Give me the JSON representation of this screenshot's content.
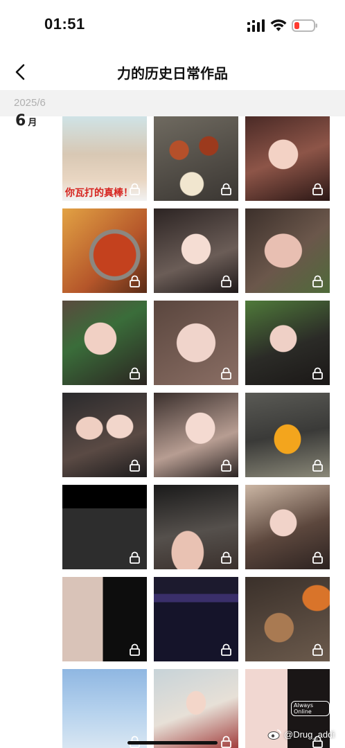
{
  "status_bar": {
    "time": "01:51",
    "icons": [
      "signal-icon",
      "wifi-icon",
      "battery-low-icon"
    ],
    "battery_color": "#ff3b30"
  },
  "nav": {
    "back_icon": "chevron-left-icon",
    "title": "力的历史日常作品"
  },
  "section": {
    "date_header": "2025/6",
    "month_number": "6",
    "month_unit": "月"
  },
  "thumbnails": [
    {
      "id": "illustrated-comic-caption",
      "caption": "你瓦打的真棒！",
      "locked": true
    },
    {
      "id": "takeout-food-boxes",
      "locked": true
    },
    {
      "id": "selfie-girl-red-nails",
      "locked": true
    },
    {
      "id": "spicy-hotpot-dish",
      "locked": true
    },
    {
      "id": "selfie-girl-pout",
      "locked": true
    },
    {
      "id": "blurry-selfie-kiss",
      "locked": true
    },
    {
      "id": "selfie-girl-hand-chin",
      "locked": true
    },
    {
      "id": "blurry-selfie-closeup",
      "locked": true
    },
    {
      "id": "selfie-girl-plants",
      "locked": true
    },
    {
      "id": "two-girls-selfie",
      "locked": true
    },
    {
      "id": "selfie-girl-hand-face",
      "locked": true
    },
    {
      "id": "orange-juice-glass",
      "locked": true
    },
    {
      "id": "dark-video-call",
      "locked": true
    },
    {
      "id": "car-selfie",
      "locked": true
    },
    {
      "id": "selfie-long-hair",
      "locked": true
    },
    {
      "id": "chat-screenshot-glasses",
      "locked": true
    },
    {
      "id": "game-scoreboard-screen",
      "locked": true
    },
    {
      "id": "iced-coffee-table",
      "locked": true
    },
    {
      "id": "sky-tower-photo",
      "locked": true
    },
    {
      "id": "store-girl-devil-horns",
      "locked": true
    },
    {
      "id": "always-online-collage",
      "caption": "Always Online",
      "locked": true
    }
  ],
  "watermark": {
    "icon": "weibo-icon",
    "text": "@Drug_addi"
  }
}
